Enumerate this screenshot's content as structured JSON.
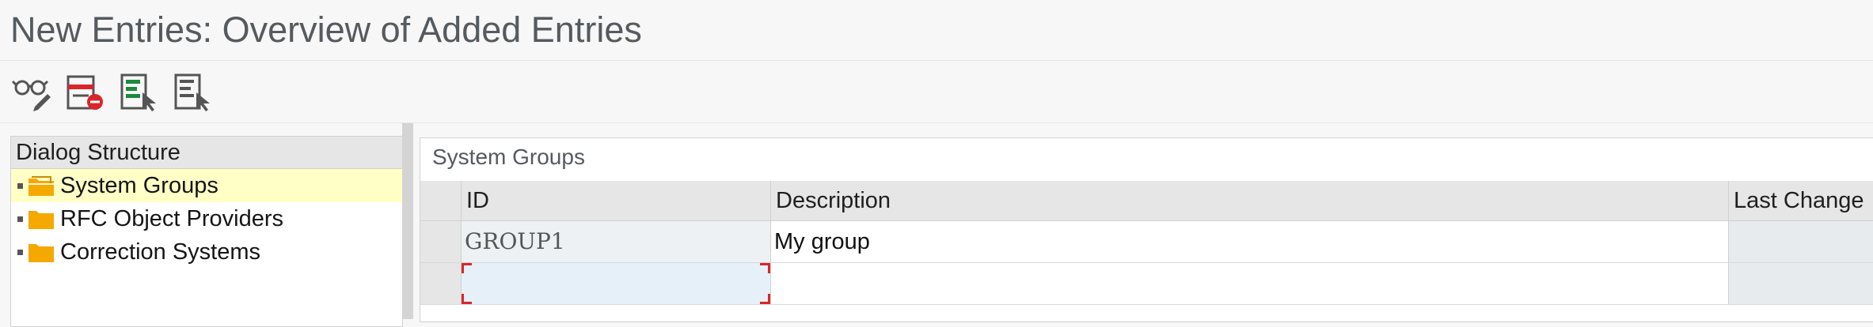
{
  "header": {
    "title": "New Entries: Overview of Added Entries"
  },
  "toolbar": {
    "buttons": [
      {
        "icon": "display-change-icon"
      },
      {
        "icon": "delete-entry-icon"
      },
      {
        "icon": "select-all-icon"
      },
      {
        "icon": "select-block-icon"
      }
    ]
  },
  "dialog_structure": {
    "title": "Dialog Structure",
    "items": [
      {
        "label": "System Groups",
        "selected": true,
        "icon": "open-folder-icon"
      },
      {
        "label": "RFC Object Providers",
        "selected": false,
        "icon": "folder-icon"
      },
      {
        "label": "Correction Systems",
        "selected": false,
        "icon": "folder-icon"
      }
    ]
  },
  "system_groups": {
    "title": "System Groups",
    "columns": [
      "ID",
      "Description",
      "Last Change"
    ],
    "rows": [
      {
        "id": "GROUP1",
        "description": "My group",
        "last_change": ""
      },
      {
        "id": "",
        "description": "",
        "last_change": ""
      }
    ]
  },
  "colors": {
    "selected_row": "#ffffc6",
    "folder": "#f5a800",
    "focus_border": "#d9262b",
    "header_bg": "#e6e6e6"
  }
}
